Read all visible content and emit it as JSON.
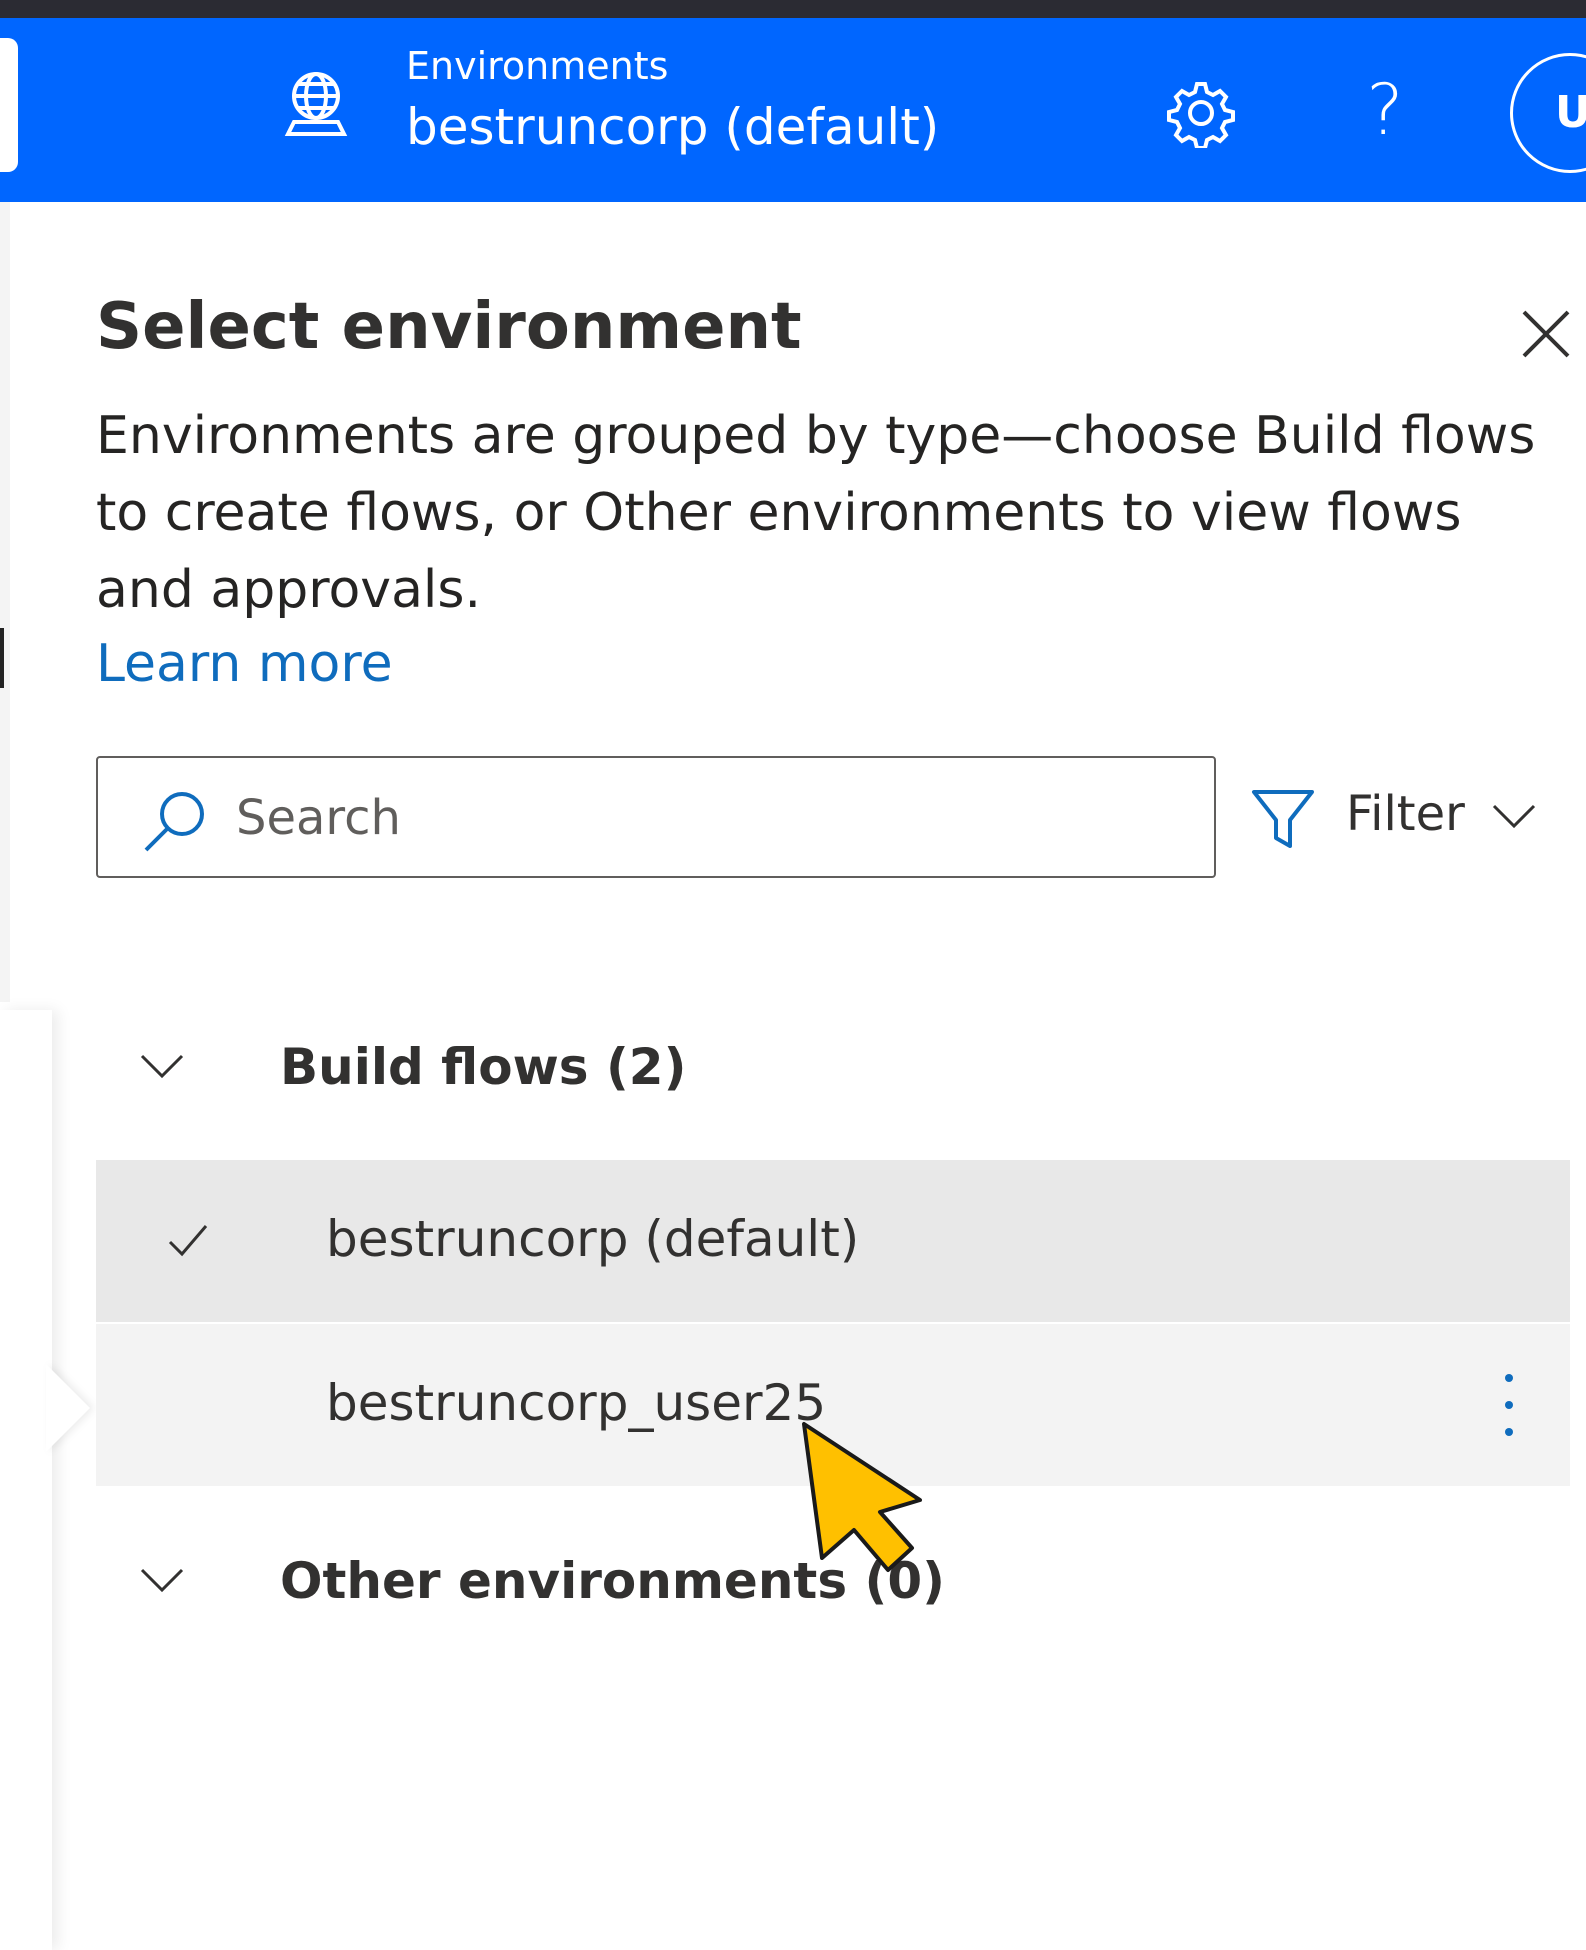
{
  "header": {
    "caption": "Environments",
    "current_environment": "bestruncorp (default)",
    "avatar_initial": "U",
    "icons": [
      "globe-icon",
      "gear-icon",
      "help-icon"
    ],
    "brand_color": "#0066ff"
  },
  "panel": {
    "title": "Select environment",
    "description": "Environments are grouped by type—choose Build flows to create flows, or Other environments to view flows and approvals.",
    "learn_more": "Learn more",
    "search": {
      "placeholder": "Search",
      "value": ""
    },
    "filter_label": "Filter",
    "groups": [
      {
        "label": "Build flows (2)",
        "expanded": true,
        "items": [
          {
            "label": "bestruncorp (default)",
            "selected": true
          },
          {
            "label": "bestruncorp_user25",
            "selected": false,
            "hovered": true
          }
        ]
      },
      {
        "label": "Other environments (0)",
        "expanded": true,
        "items": []
      }
    ]
  },
  "colors": {
    "link": "#0f6cbd",
    "selected_row": "#e8e8e8",
    "hovered_row": "#f3f3f3",
    "cursor": "#ffc000"
  }
}
